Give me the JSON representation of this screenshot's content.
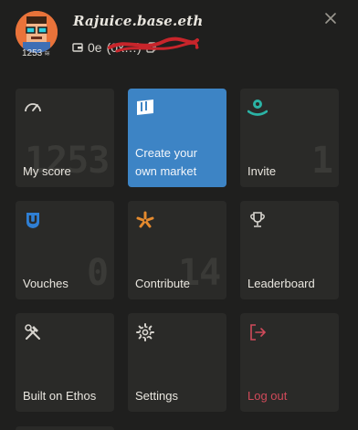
{
  "profile": {
    "name": "Rajuice.base.eth",
    "score": "1253",
    "address_prefix": "0e",
    "address_masked": "(0x…)"
  },
  "tiles": [
    {
      "label": "My score",
      "bg_number": "1253"
    },
    {
      "label": "Create your own market"
    },
    {
      "label": "Invite",
      "bg_number": "1"
    },
    {
      "label": "Vouches",
      "bg_number": "0"
    },
    {
      "label": "Contribute",
      "bg_number": "14"
    },
    {
      "label": "Leaderboard"
    },
    {
      "label": "Built on Ethos"
    },
    {
      "label": "Settings"
    },
    {
      "label": "Log out"
    }
  ],
  "colors": {
    "background": "#1f1f1e",
    "tile": "#2a2a28",
    "accent_blue": "#3d84c5",
    "teal": "#2bb3a5",
    "vouch_blue": "#2f7fd4",
    "orange": "#e58a2e",
    "logout_red": "#d04a5a"
  },
  "icons": {
    "my_score": "speedometer-icon",
    "market": "market-bars-icon",
    "invite": "invite-user-icon",
    "vouches": "vouch-shield-icon",
    "contribute": "asterisk-star-icon",
    "leaderboard": "trophy-icon",
    "built_on": "hammer-wrench-icon",
    "settings": "gear-icon",
    "logout": "logout-icon",
    "close": "close-icon",
    "wallet": "wallet-icon",
    "copy": "copy-icon"
  }
}
